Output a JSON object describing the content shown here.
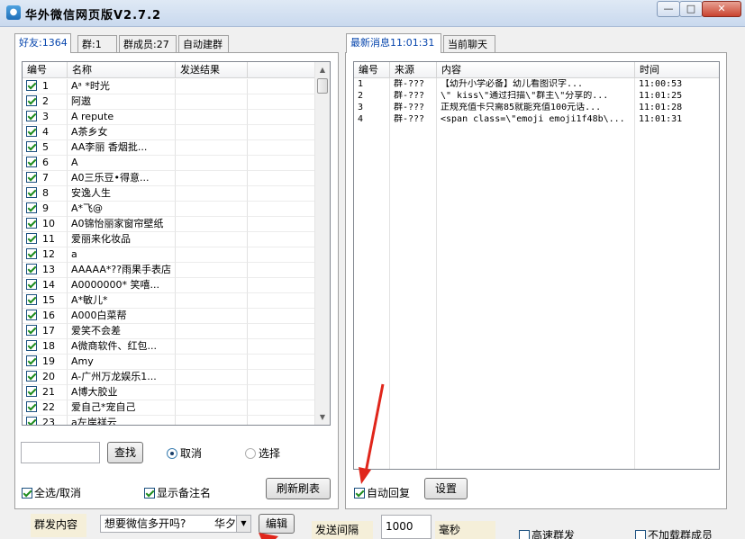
{
  "window": {
    "icon_glyph": "●",
    "title": "华外微信网页版V2.7.2",
    "min_glyph": "—",
    "max_glyph": "□",
    "close_glyph": "✕"
  },
  "left_tabs": [
    {
      "label": "好友:1364",
      "active": true
    },
    {
      "label": "群:1",
      "active": false
    },
    {
      "label": "群成员:27",
      "active": false
    },
    {
      "label": "自动建群",
      "active": false
    }
  ],
  "friend_list": {
    "columns": [
      "编号",
      "名称",
      "发送结果"
    ],
    "rows": [
      {
        "no": "1",
        "name": "Aᵃ *时光",
        "checked": true
      },
      {
        "no": "2",
        "name": "阿遨",
        "checked": true
      },
      {
        "no": "3",
        "name": "A   repute",
        "checked": true
      },
      {
        "no": "4",
        "name": "A茶乡女",
        "checked": true
      },
      {
        "no": "5",
        "name": "AA李丽  香烟批...",
        "checked": true
      },
      {
        "no": "6",
        "name": "A",
        "checked": true
      },
      {
        "no": "7",
        "name": "A0三乐豆•得意...",
        "checked": true
      },
      {
        "no": "8",
        "name": "安逸人生",
        "checked": true
      },
      {
        "no": "9",
        "name": "A*飞@",
        "checked": true
      },
      {
        "no": "10",
        "name": "A0锦怡丽家窗帘壁纸",
        "checked": true
      },
      {
        "no": "11",
        "name": "爱丽来化妆品",
        "checked": true
      },
      {
        "no": "12",
        "name": "a",
        "checked": true
      },
      {
        "no": "13",
        "name": "AAAAA*??雨果手表店",
        "checked": true
      },
      {
        "no": "14",
        "name": "A0000000* 笑嘻...",
        "checked": true
      },
      {
        "no": "15",
        "name": "A*敏儿*",
        "checked": true
      },
      {
        "no": "16",
        "name": "A000白菜帮",
        "checked": true
      },
      {
        "no": "17",
        "name": "爱笑不会差",
        "checked": true
      },
      {
        "no": "18",
        "name": "A微商软件、红包...",
        "checked": true
      },
      {
        "no": "19",
        "name": "Amy",
        "checked": true
      },
      {
        "no": "20",
        "name": "A-广州万龙娱乐1...",
        "checked": true
      },
      {
        "no": "21",
        "name": "A博大胶业",
        "checked": true
      },
      {
        "no": "22",
        "name": "爱自己*宠自己",
        "checked": true
      },
      {
        "no": "23",
        "name": "a左岸祥云",
        "checked": true
      }
    ]
  },
  "right_tabs": [
    {
      "label": "最新消息11:01:31",
      "active": true
    },
    {
      "label": "当前聊天",
      "active": false
    }
  ],
  "message_list": {
    "columns": [
      "编号",
      "来源",
      "内容",
      "时间"
    ],
    "rows": [
      {
        "no": "1",
        "source": "群-???",
        "content": "  【幼升小学必备】幼儿看图识字...",
        "time": "11:00:53"
      },
      {
        "no": "2",
        "source": "群-???",
        "content": "\\\" kiss\\\"通过扫描\\\"群主\\\"分享的...",
        "time": "11:01:25"
      },
      {
        "no": "3",
        "source": "群-???",
        "content": "正规充值卡只需85就能充值100元话...",
        "time": "11:01:28"
      },
      {
        "no": "4",
        "source": "群-???",
        "content": "<span class=\\\"emoji emoji1f48b\\...",
        "time": "11:01:31"
      }
    ]
  },
  "scroll": {
    "up": "▲",
    "down": "▼"
  },
  "search": {
    "value": "",
    "button": "查找"
  },
  "radios": [
    {
      "label": "取消",
      "selected": true
    },
    {
      "label": "选择",
      "selected": false
    }
  ],
  "checkboxes": {
    "select_all": {
      "label": "全选/取消",
      "checked": true
    },
    "show_remark": {
      "label": "显示备注名",
      "checked": true
    },
    "auto_reply": {
      "label": "自动回复",
      "checked": true
    },
    "fast_send": {
      "label": "高速群发",
      "checked": false
    },
    "no_load_members": {
      "label": "不加载群成员",
      "checked": false
    }
  },
  "buttons": {
    "refresh": "刷新刷表",
    "settings": "设置",
    "edit": "编辑"
  },
  "bottom": {
    "mass_content_label": "群发内容",
    "mass_content_value": "想要微信多开吗?",
    "mass_content_suffix": "华夕",
    "interval_label": "发送间隔",
    "interval_value": "1000",
    "interval_unit": "毫秒"
  },
  "colors": {
    "annotation_arrow": "#e0261b",
    "active_tab_text": "#0645ad"
  }
}
